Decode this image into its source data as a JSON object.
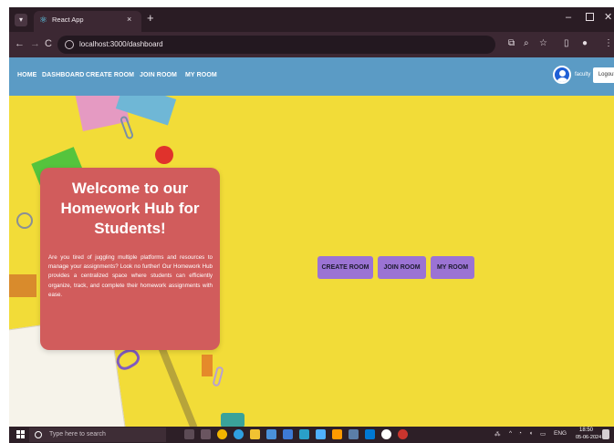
{
  "browser": {
    "tab_title": "React App",
    "url": "localhost:3000/dashboard",
    "new_tab_label": "+",
    "tab_close_label": "×",
    "back_label": "←",
    "forward_label": "→",
    "reload_label": "C",
    "min_label": "–",
    "close_label": "✕"
  },
  "navbar": {
    "items": [
      "HOME",
      "DASHBOARD",
      "CREATE ROOM",
      "JOIN ROOM",
      "MY ROOM"
    ],
    "user_label": "faculty",
    "logout_label": "Logout"
  },
  "hero": {
    "title": "Welcome to our Homework Hub for Students!",
    "body": "Are you tired of juggling multiple platforms and resources to manage your assignments? Look no further! Our Homework Hub provides a centralized space where students can efficiently organize, track, and complete their homework assignments with ease."
  },
  "actions": [
    "CREATE ROOM",
    "JOIN ROOM",
    "MY ROOM"
  ],
  "taskbar": {
    "search_placeholder": "Type here to search",
    "language": "ENG",
    "time": "18:50",
    "date": "05-06-2024"
  },
  "colors": {
    "navbar": "#5b9bc5",
    "hero_background": "#f2dc38",
    "card": "#d15c5c",
    "action_button": "#9b73d4"
  }
}
